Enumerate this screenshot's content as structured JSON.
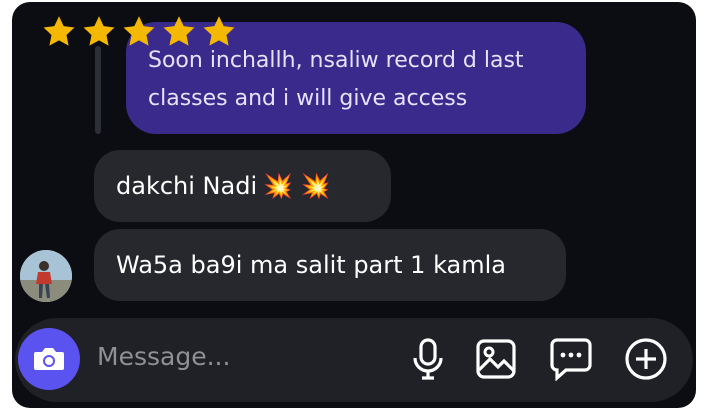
{
  "rating": {
    "stars": 5,
    "max": 5,
    "color": "#f5b800"
  },
  "messages": [
    {
      "direction": "sent",
      "text": "Soon inchallh, nsaliw record d last classes and i will give access",
      "color": "#3a2a8c"
    },
    {
      "direction": "received",
      "text": "dakchi Nadi",
      "emoji": "💥 💥"
    },
    {
      "direction": "received",
      "text": "Wa5a ba9i ma salit part 1 kamla"
    }
  ],
  "composer": {
    "placeholder": "Message...",
    "icons": [
      "camera-icon",
      "microphone-icon",
      "image-icon",
      "chat-icon",
      "plus-icon"
    ],
    "accent": "#5a53f0"
  }
}
